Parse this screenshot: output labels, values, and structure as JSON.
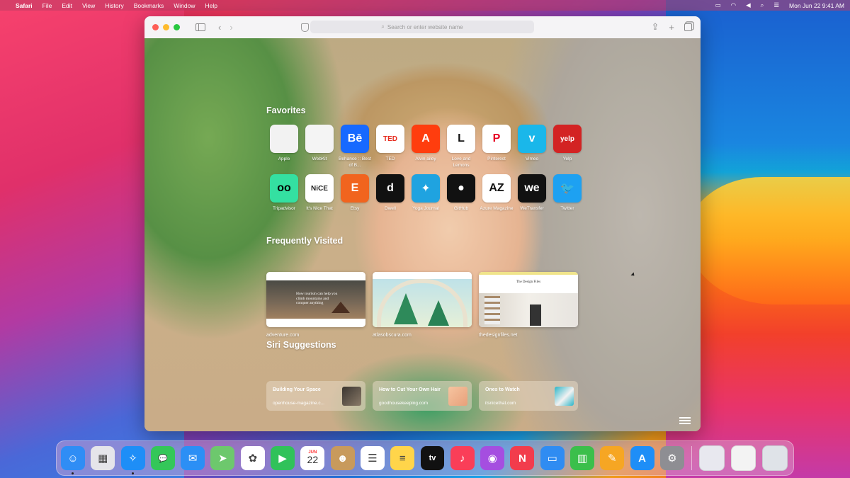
{
  "menubar": {
    "app_name": "Safari",
    "items": [
      "File",
      "Edit",
      "View",
      "History",
      "Bookmarks",
      "Window",
      "Help"
    ],
    "clock": "Mon Jun 22  9:41 AM"
  },
  "toolbar": {
    "search_placeholder": "Search or enter website name"
  },
  "favorites": {
    "title": "Favorites",
    "items": [
      {
        "label": "Apple",
        "tile_text": "",
        "bg": "#f2f2f2",
        "fg": "#555555",
        "icon": "apple-logo"
      },
      {
        "label": "WebKit",
        "tile_text": "",
        "bg": "#f4f4f4",
        "fg": "#3fa2f0",
        "icon": "webkit-compass"
      },
      {
        "label": "Behance :: Best of B...",
        "tile_text": "Bē",
        "bg": "#1769ff",
        "fg": "#ffffff",
        "icon": "behance-logo"
      },
      {
        "label": "TED",
        "tile_text": "TED",
        "bg": "#ffffff",
        "fg": "#e62b1e",
        "icon": "ted-logo"
      },
      {
        "label": "Alvin ailey",
        "tile_text": "A",
        "bg": "#ff3d0e",
        "fg": "#ffffff",
        "icon": "ailey-logo"
      },
      {
        "label": "Love and Lemons",
        "tile_text": "L",
        "bg": "#ffffff",
        "fg": "#111111",
        "icon": "love-lemons-logo"
      },
      {
        "label": "Pinterest",
        "tile_text": "P",
        "bg": "#ffffff",
        "fg": "#e60023",
        "icon": "pinterest-logo"
      },
      {
        "label": "Vimeo",
        "tile_text": "v",
        "bg": "#1ab7ea",
        "fg": "#ffffff",
        "icon": "vimeo-logo"
      },
      {
        "label": "Yelp",
        "tile_text": "yelp",
        "bg": "#d32323",
        "fg": "#ffffff",
        "icon": "yelp-logo"
      },
      {
        "label": "Tripadvisor",
        "tile_text": "oo",
        "bg": "#34e0a1",
        "fg": "#000000",
        "icon": "tripadvisor-logo"
      },
      {
        "label": "It's Nice That",
        "tile_text": "NiCE",
        "bg": "#ffffff",
        "fg": "#222222",
        "icon": "its-nice-that-logo"
      },
      {
        "label": "Etsy",
        "tile_text": "E",
        "bg": "#f1641e",
        "fg": "#ffffff",
        "icon": "etsy-logo"
      },
      {
        "label": "Dwell",
        "tile_text": "d",
        "bg": "#111111",
        "fg": "#ffffff",
        "icon": "dwell-logo"
      },
      {
        "label": "Yoga Journal",
        "tile_text": "✦",
        "bg": "#1fa3e0",
        "fg": "#ffffff",
        "icon": "yoga-journal-logo"
      },
      {
        "label": "GitHub",
        "tile_text": "●",
        "bg": "#111111",
        "fg": "#ffffff",
        "icon": "github-logo"
      },
      {
        "label": "Azure Magazine",
        "tile_text": "AZ",
        "bg": "#ffffff",
        "fg": "#111111",
        "icon": "azure-logo"
      },
      {
        "label": "WeTransfer",
        "tile_text": "we",
        "bg": "#111111",
        "fg": "#ffffff",
        "icon": "wetransfer-logo"
      },
      {
        "label": "Twitter",
        "tile_text": "🐦",
        "bg": "#1da1f2",
        "fg": "#ffffff",
        "icon": "twitter-logo"
      }
    ]
  },
  "frequently_visited": {
    "title": "Frequently Visited",
    "items": [
      {
        "label": "adventure.com",
        "thumb_headline": "How tourism can help you climb mountains and conquer anything"
      },
      {
        "label": "atlasobscura.com",
        "thumb_headline": ""
      },
      {
        "label": "thedesignfiles.net",
        "thumb_headline": "The Design Files"
      }
    ]
  },
  "siri_suggestions": {
    "title": "Siri Suggestions",
    "items": [
      {
        "title": "Building Your Space",
        "source": "openhouse-magazine.c..."
      },
      {
        "title": "How to Cut Your Own Hair",
        "source": "goodhousekeeping.com"
      },
      {
        "title": "Ones to Watch",
        "source": "itsnicethat.com"
      }
    ]
  },
  "dock": {
    "apps": [
      {
        "name": "Finder",
        "bg": "#2f8df5",
        "glyph": "☺",
        "running": true
      },
      {
        "name": "Launchpad",
        "bg": "#e5e5ea",
        "glyph": "▦",
        "running": false
      },
      {
        "name": "Safari",
        "bg": "#1e8ef7",
        "glyph": "✧",
        "running": true
      },
      {
        "name": "Messages",
        "bg": "#34c759",
        "glyph": "💬",
        "running": false
      },
      {
        "name": "Mail",
        "bg": "#2b8ff5",
        "glyph": "✉",
        "running": false
      },
      {
        "name": "Maps",
        "bg": "#6dc86d",
        "glyph": "➤",
        "running": false
      },
      {
        "name": "Photos",
        "bg": "#ffffff",
        "glyph": "✿",
        "running": false
      },
      {
        "name": "FaceTime",
        "bg": "#30c25a",
        "glyph": "▶",
        "running": false
      },
      {
        "name": "Calendar",
        "bg": "#ffffff",
        "glyph": "22",
        "running": false
      },
      {
        "name": "Contacts",
        "bg": "#c89a5c",
        "glyph": "☻",
        "running": false
      },
      {
        "name": "Reminders",
        "bg": "#ffffff",
        "glyph": "☰",
        "running": false
      },
      {
        "name": "Notes",
        "bg": "#ffd54a",
        "glyph": "≡",
        "running": false
      },
      {
        "name": "Apple TV",
        "bg": "#111111",
        "glyph": "tv",
        "running": false
      },
      {
        "name": "Music",
        "bg": "#fa3e58",
        "glyph": "♪",
        "running": false
      },
      {
        "name": "Podcasts",
        "bg": "#a54ee0",
        "glyph": "◉",
        "running": false
      },
      {
        "name": "News",
        "bg": "#f23c4c",
        "glyph": "N",
        "running": false
      },
      {
        "name": "Keynote",
        "bg": "#2f8cf2",
        "glyph": "▭",
        "running": false
      },
      {
        "name": "Numbers",
        "bg": "#3bbf4b",
        "glyph": "▥",
        "running": false
      },
      {
        "name": "Pages",
        "bg": "#f6a623",
        "glyph": "✎",
        "running": false
      },
      {
        "name": "App Store",
        "bg": "#1e8ef7",
        "glyph": "A",
        "running": false
      },
      {
        "name": "System Preferences",
        "bg": "#8e8e93",
        "glyph": "⚙",
        "running": false
      }
    ],
    "calendar_month": "JUN",
    "calendar_day": "22",
    "extras": [
      {
        "name": "Downloads stack",
        "bg": "#e8e8ef"
      },
      {
        "name": "Recent window",
        "bg": "#f3f3f3"
      },
      {
        "name": "Trash",
        "bg": "#dfe3e8"
      }
    ]
  },
  "colors": {
    "accent_blue": "#1e8ef7",
    "traffic_red": "#fe5f57",
    "traffic_yellow": "#febb2e",
    "traffic_green": "#28c840"
  }
}
